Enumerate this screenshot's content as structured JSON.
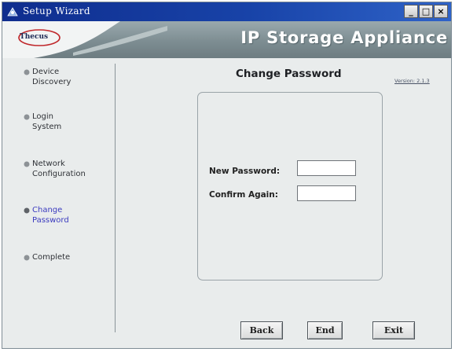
{
  "window": {
    "title": "Setup Wizard",
    "controls": {
      "minimize": "_",
      "maximize": "□",
      "close": "×"
    }
  },
  "banner": {
    "logo": "Thecus",
    "title": "IP Storage Appliance"
  },
  "sidebar": {
    "steps": [
      {
        "label": "Device\nDiscovery",
        "active": false
      },
      {
        "label": "Login\nSystem",
        "active": false
      },
      {
        "label": "Network\nConfiguration",
        "active": false
      },
      {
        "label": "Change\nPassword",
        "active": true
      },
      {
        "label": "Complete",
        "active": false
      }
    ]
  },
  "main": {
    "title": "Change Password",
    "version": "Version: 2.1.3",
    "form": {
      "new_password": {
        "label": "New Password:",
        "value": ""
      },
      "confirm_again": {
        "label": "Confirm Again:",
        "value": ""
      }
    }
  },
  "buttons": {
    "back": "Back",
    "end": "End",
    "exit": "Exit"
  },
  "colors": {
    "titlebar": "#1843a8",
    "banner": "#7d8d92",
    "background": "#e9ecec",
    "active_step": "#3b3bbf"
  }
}
